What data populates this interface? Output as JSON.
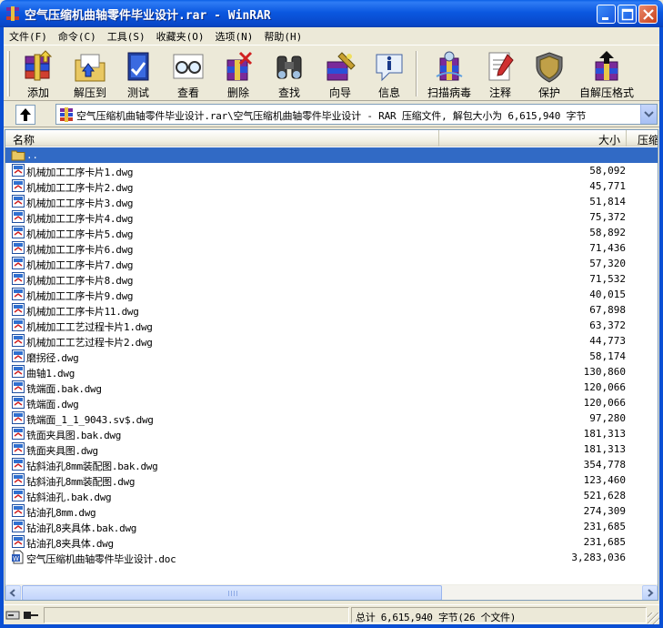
{
  "window": {
    "title": "空气压缩机曲轴零件毕业设计.rar - WinRAR"
  },
  "menu": [
    {
      "label": "文件(F)"
    },
    {
      "label": "命令(C)"
    },
    {
      "label": "工具(S)"
    },
    {
      "label": "收藏夹(O)"
    },
    {
      "label": "选项(N)"
    },
    {
      "label": "帮助(H)"
    }
  ],
  "toolbar": {
    "add": "添加",
    "extract_to": "解压到",
    "test": "测试",
    "view": "查看",
    "delete": "删除",
    "find": "查找",
    "wizard": "向导",
    "info": "信息",
    "scan": "扫描病毒",
    "comment": "注释",
    "protect": "保护",
    "sfx": "自解压格式"
  },
  "address": {
    "path": "空气压缩机曲轴零件毕业设计.rar\\空气压缩机曲轴零件毕业设计 - RAR 压缩文件, 解包大小为 6,615,940 字节"
  },
  "columns": {
    "name": "名称",
    "size": "大小",
    "packed": "压缩"
  },
  "files": [
    {
      "name": "..",
      "size": "",
      "type": "folder"
    },
    {
      "name": "机械加工工序卡片1.dwg",
      "size": "58,092",
      "type": "dwg"
    },
    {
      "name": "机械加工工序卡片2.dwg",
      "size": "45,771",
      "type": "dwg"
    },
    {
      "name": "机械加工工序卡片3.dwg",
      "size": "51,814",
      "type": "dwg"
    },
    {
      "name": "机械加工工序卡片4.dwg",
      "size": "75,372",
      "type": "dwg"
    },
    {
      "name": "机械加工工序卡片5.dwg",
      "size": "58,892",
      "type": "dwg"
    },
    {
      "name": "机械加工工序卡片6.dwg",
      "size": "71,436",
      "type": "dwg"
    },
    {
      "name": "机械加工工序卡片7.dwg",
      "size": "57,320",
      "type": "dwg"
    },
    {
      "name": "机械加工工序卡片8.dwg",
      "size": "71,532",
      "type": "dwg"
    },
    {
      "name": "机械加工工序卡片9.dwg",
      "size": "40,015",
      "type": "dwg"
    },
    {
      "name": "机械加工工序卡片11.dwg",
      "size": "67,898",
      "type": "dwg"
    },
    {
      "name": "机械加工工艺过程卡片1.dwg",
      "size": "63,372",
      "type": "dwg"
    },
    {
      "name": "机械加工工艺过程卡片2.dwg",
      "size": "44,773",
      "type": "dwg"
    },
    {
      "name": "磨拐径.dwg",
      "size": "58,174",
      "type": "dwg"
    },
    {
      "name": "曲轴1.dwg",
      "size": "130,860",
      "type": "dwg"
    },
    {
      "name": "铣端面.bak.dwg",
      "size": "120,066",
      "type": "dwg"
    },
    {
      "name": "铣端面.dwg",
      "size": "120,066",
      "type": "dwg"
    },
    {
      "name": "铣端面_1_1_9043.sv$.dwg",
      "size": "97,280",
      "type": "dwg"
    },
    {
      "name": "铣面夹具图.bak.dwg",
      "size": "181,313",
      "type": "dwg"
    },
    {
      "name": "铣面夹具图.dwg",
      "size": "181,313",
      "type": "dwg"
    },
    {
      "name": "钻斜油孔8mm装配图.bak.dwg",
      "size": "354,778",
      "type": "dwg"
    },
    {
      "name": "钻斜油孔8mm装配图.dwg",
      "size": "123,460",
      "type": "dwg"
    },
    {
      "name": "钻斜油孔.bak.dwg",
      "size": "521,628",
      "type": "dwg"
    },
    {
      "name": "钻油孔8mm.dwg",
      "size": "274,309",
      "type": "dwg"
    },
    {
      "name": "钻油孔8夹具体.bak.dwg",
      "size": "231,685",
      "type": "dwg"
    },
    {
      "name": "钻油孔8夹具体.dwg",
      "size": "231,685",
      "type": "dwg"
    },
    {
      "name": "空气压缩机曲轴零件毕业设计.doc",
      "size": "3,283,036",
      "type": "doc"
    }
  ],
  "status": {
    "left": "",
    "total": "总计 6,615,940 字节(26 个文件)"
  }
}
